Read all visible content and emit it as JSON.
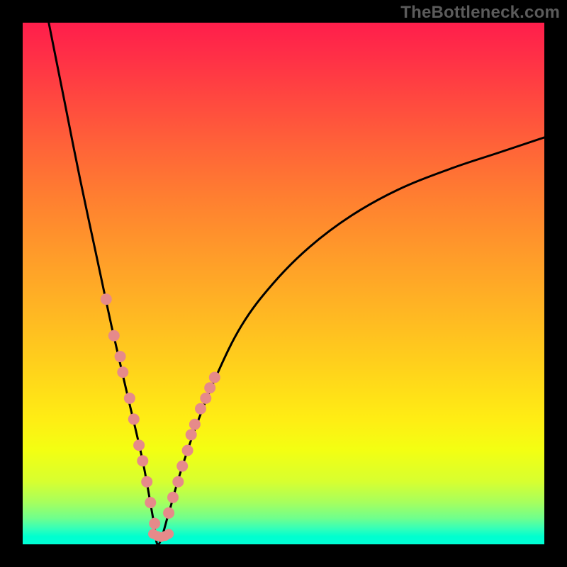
{
  "watermark": "TheBottleneck.com",
  "colors": {
    "frame": "#000000",
    "curve": "#000000",
    "dots": "#e68a8a",
    "gradient_top": "#ff1e4b",
    "gradient_bottom": "#00ffd6"
  },
  "chart_data": {
    "type": "line",
    "title": "",
    "xlabel": "",
    "ylabel": "",
    "xlim": [
      0,
      100
    ],
    "ylim": [
      0,
      100
    ],
    "description": "V-shaped bottleneck curve on red-to-green vertical gradient; minimum near x≈26 at y=0; left branch falls from (5,100) to (26,0); right branch rises asymptotically toward ~y=78 at x=100. Salmon dots highlight both branches roughly over y∈[2,30].",
    "series": [
      {
        "name": "left-branch",
        "x": [
          5,
          8,
          11,
          14,
          17,
          20,
          23,
          25,
          26
        ],
        "values": [
          100,
          85,
          70,
          56,
          42,
          29,
          16,
          5,
          0
        ]
      },
      {
        "name": "right-branch",
        "x": [
          26,
          28,
          30,
          33,
          37,
          42,
          48,
          55,
          63,
          72,
          82,
          91,
          100
        ],
        "values": [
          0,
          6,
          13,
          22,
          32,
          42,
          50,
          57,
          63,
          68,
          72,
          75,
          78
        ]
      }
    ],
    "highlight_dots_zone": {
      "y_min": 2,
      "y_max": 30
    },
    "highlight_dots": {
      "left": [
        [
          16.0,
          47
        ],
        [
          17.5,
          40
        ],
        [
          18.7,
          36
        ],
        [
          19.2,
          33
        ],
        [
          20.5,
          28
        ],
        [
          21.3,
          24
        ],
        [
          22.3,
          19
        ],
        [
          23.0,
          16
        ],
        [
          23.8,
          12
        ],
        [
          24.5,
          8
        ],
        [
          25.3,
          4
        ]
      ],
      "right": [
        [
          28.0,
          6
        ],
        [
          28.8,
          9
        ],
        [
          29.8,
          12
        ],
        [
          30.6,
          15
        ],
        [
          31.6,
          18
        ],
        [
          32.3,
          21
        ],
        [
          33.0,
          23
        ],
        [
          34.1,
          26
        ],
        [
          35.1,
          28
        ],
        [
          35.9,
          30
        ],
        [
          36.8,
          32
        ]
      ],
      "bottom": [
        [
          25.0,
          2.0
        ],
        [
          25.8,
          1.6
        ],
        [
          26.5,
          1.4
        ],
        [
          27.3,
          1.6
        ],
        [
          28.0,
          2.0
        ]
      ]
    }
  }
}
